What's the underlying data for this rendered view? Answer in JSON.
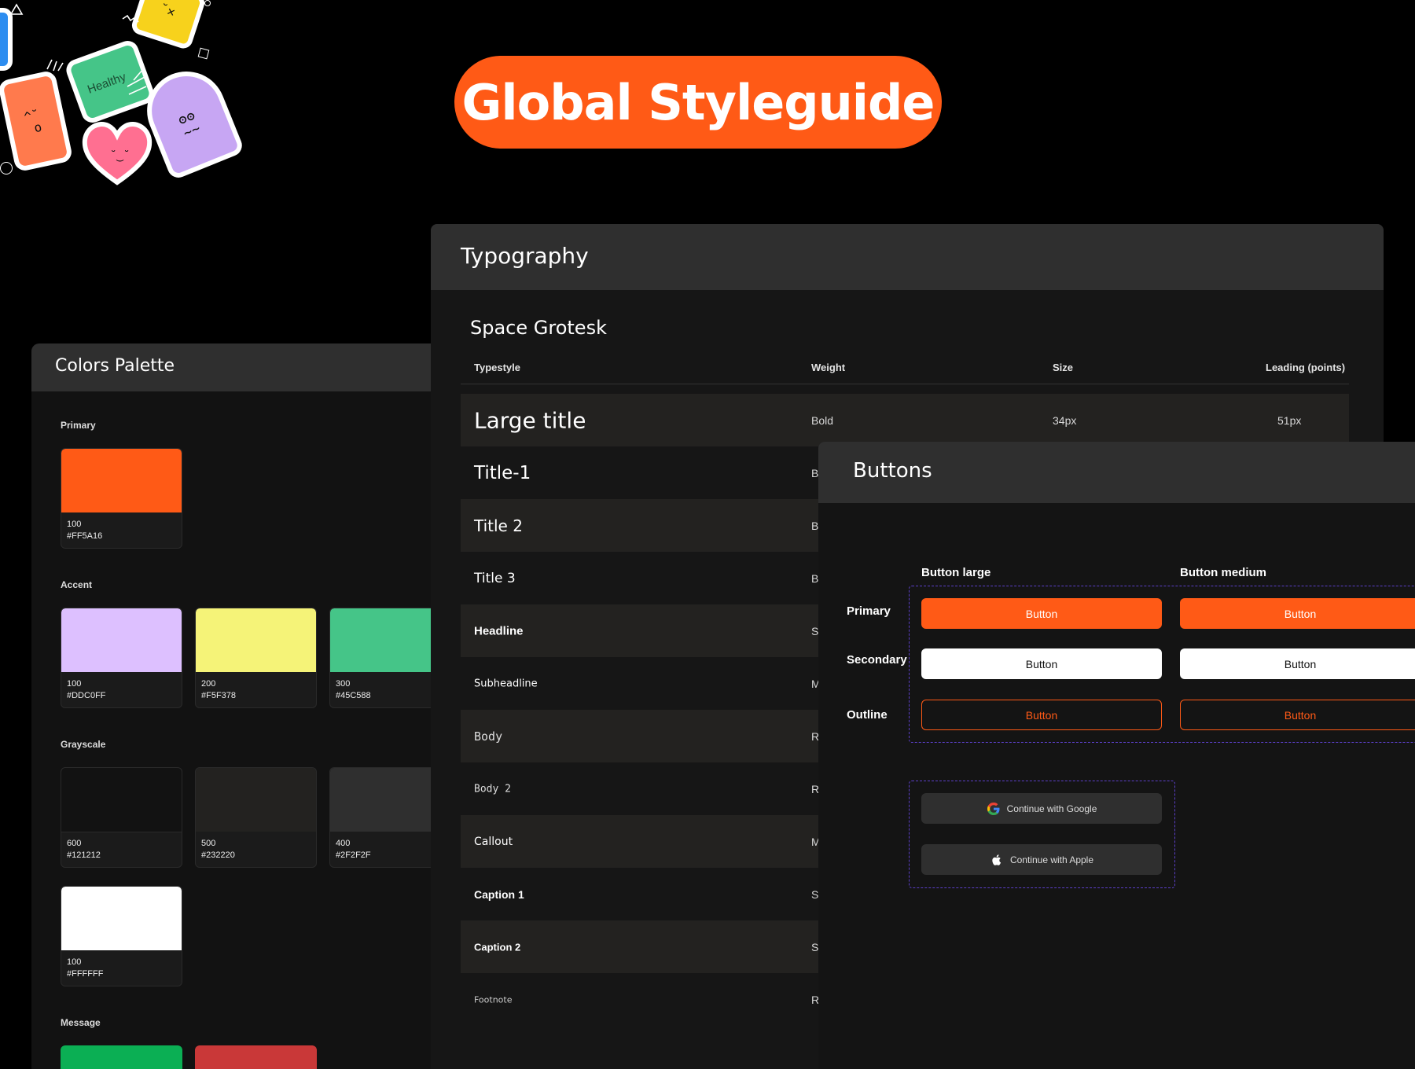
{
  "hero": {
    "title": "Global Styleguide"
  },
  "stickers": {
    "healthy_label": "Healthy"
  },
  "colors_palette": {
    "title": "Colors Palette",
    "sections": {
      "primary": {
        "label": "Primary",
        "swatches": [
          {
            "shade": "100",
            "hex": "#FF5A16",
            "color": "#FF5A16"
          }
        ]
      },
      "accent": {
        "label": "Accent",
        "swatches": [
          {
            "shade": "100",
            "hex": "#DDC0FF",
            "color": "#DDC0FF"
          },
          {
            "shade": "200",
            "hex": "#F5F378",
            "color": "#F5F378"
          },
          {
            "shade": "300",
            "hex": "#45C588",
            "color": "#45C588"
          }
        ]
      },
      "grayscale": {
        "label": "Grayscale",
        "swatches": [
          {
            "shade": "600",
            "hex": "#121212",
            "color": "#121212"
          },
          {
            "shade": "500",
            "hex": "#232220",
            "color": "#232220"
          },
          {
            "shade": "400",
            "hex": "#2F2F2F",
            "color": "#2F2F2F"
          },
          {
            "shade": "100",
            "hex": "#FFFFFF",
            "color": "#FFFFFF"
          }
        ]
      },
      "message": {
        "label": "Message",
        "swatches": [
          {
            "color": "#0BAF54"
          },
          {
            "color": "#C93838"
          }
        ]
      }
    }
  },
  "typography": {
    "title": "Typography",
    "font_name": "Space Grotesk",
    "columns": {
      "typestyle": "Typestyle",
      "weight": "Weight",
      "size": "Size",
      "leading": "Leading (points)"
    },
    "rows": [
      {
        "name": "Large title",
        "weight": "Bold",
        "size": "34px",
        "leading": "51px"
      },
      {
        "name": "Title-1",
        "weight": "B"
      },
      {
        "name": "Title 2",
        "weight": "B"
      },
      {
        "name": "Title 3",
        "weight": "B"
      },
      {
        "name": "Headline",
        "weight": "S"
      },
      {
        "name": "Subheadline",
        "weight": "M"
      },
      {
        "name": "Body",
        "weight": "R"
      },
      {
        "name": "Body 2",
        "weight": "R"
      },
      {
        "name": "Callout",
        "weight": "M"
      },
      {
        "name": "Caption 1",
        "weight": "S"
      },
      {
        "name": "Caption 2",
        "weight": "S"
      },
      {
        "name": "Footnote",
        "weight": "R"
      }
    ]
  },
  "buttons": {
    "title": "Buttons",
    "columns": {
      "large": "Button large",
      "medium": "Button medium"
    },
    "rows": {
      "primary": "Primary",
      "secondary": "Secondary",
      "outline": "Outline"
    },
    "button_label": "Button",
    "social": {
      "google": "Continue with Google",
      "apple": "Continue with Apple"
    }
  }
}
